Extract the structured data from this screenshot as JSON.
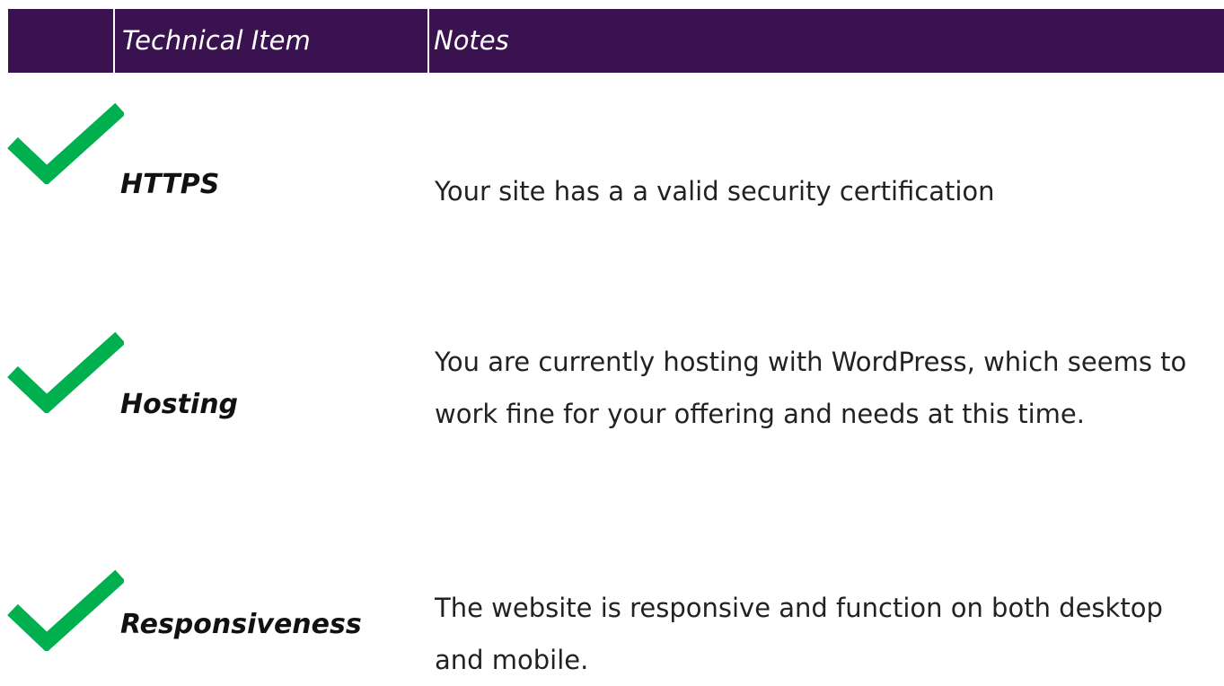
{
  "table": {
    "headers": {
      "item": "Technical Item",
      "notes": "Notes"
    },
    "rows": [
      {
        "icon": "check-icon",
        "item": "HTTPS",
        "notes": "Your site has a a valid security certification"
      },
      {
        "icon": "check-icon",
        "item": "Hosting",
        "notes": "You are currently hosting with WordPress, which seems to work fine for your offering and needs at this time."
      },
      {
        "icon": "check-icon",
        "item": "Responsiveness",
        "notes": "The website is responsive and function on both desktop and mobile."
      }
    ]
  },
  "colors": {
    "header_background": "#3a1250",
    "header_text": "#ffffff",
    "check_green": "#00b04f"
  }
}
